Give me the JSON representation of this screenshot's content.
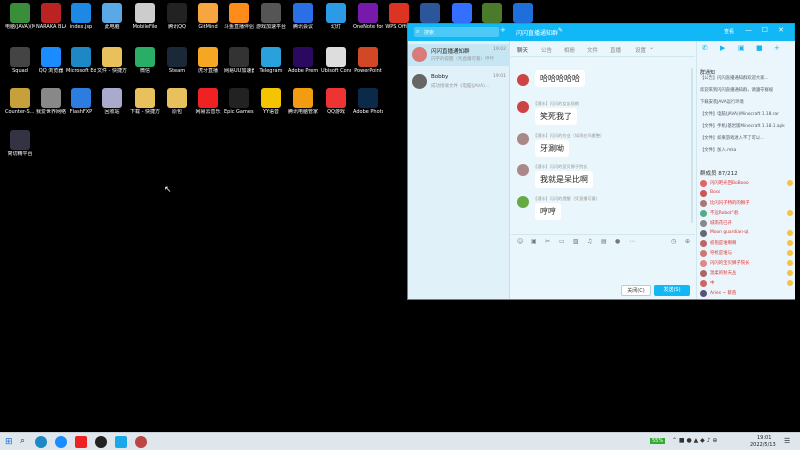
{
  "desktop": {
    "icons": [
      {
        "label": "电脑(JAVA)(Min...",
        "color": "#3a8e3a"
      },
      {
        "label": "NARAKA BLADEPOI...",
        "color": "#b22"
      },
      {
        "label": "index.jsp",
        "color": "#1e88e5"
      },
      {
        "label": "此电脑",
        "color": "#5aa9e6"
      },
      {
        "label": "MobileFile",
        "color": "#ccc"
      },
      {
        "label": "腾讯QQ",
        "color": "#222"
      },
      {
        "label": "GitMind",
        "color": "#f7a541"
      },
      {
        "label": "斗鱼直播伴侣",
        "color": "#ff8c1a"
      },
      {
        "label": "游戏加速平台",
        "color": "#555"
      },
      {
        "label": "腾讯会议",
        "color": "#2b6fe6"
      },
      {
        "label": "幻灯",
        "color": "#2b9be6"
      },
      {
        "label": "OneNote for Windo...",
        "color": "#7719aa"
      },
      {
        "label": "WPS Office",
        "color": "#d32"
      },
      {
        "label": "Word",
        "color": "#2b579a"
      },
      {
        "label": "飞书",
        "color": "#3370ff"
      },
      {
        "label": "Minecraft",
        "color": "#4a7a2a"
      },
      {
        "label": "L",
        "color": "#1e6fd9"
      },
      {
        "label": "Squad",
        "color": "#444"
      },
      {
        "label": "QQ 浏览器",
        "color": "#1a8cff"
      },
      {
        "label": "Microsoft Edge",
        "color": "#1e88c5"
      },
      {
        "label": "文件 - 快捷方式",
        "color": "#e8c15c"
      },
      {
        "label": "微信",
        "color": "#2aae67"
      },
      {
        "label": "Steam",
        "color": "#1b2838"
      },
      {
        "label": "虎牙直播",
        "color": "#f5a623"
      },
      {
        "label": "网易UU加速器",
        "color": "#333"
      },
      {
        "label": "Telegram",
        "color": "#2aa1da"
      },
      {
        "label": "Adobe Premie...",
        "color": "#2a0a5e"
      },
      {
        "label": "Ubisoft Connect",
        "color": "#ddd"
      },
      {
        "label": "PowerPoint",
        "color": "#d24726"
      },
      {
        "label": "Counter-S... Global Off...",
        "color": "#c6a03a"
      },
      {
        "label": "我爱世界网络平台",
        "color": "#888"
      },
      {
        "label": "FlashFXP",
        "color": "#2d7de0"
      },
      {
        "label": "回收站",
        "color": "#aac"
      },
      {
        "label": "下载 - 快捷方式",
        "color": "#e8c15c"
      },
      {
        "label": "原包",
        "color": "#e8c15c"
      },
      {
        "label": "网易云音乐",
        "color": "#e22"
      },
      {
        "label": "Epic Games Launcher",
        "color": "#222"
      },
      {
        "label": "YY语音",
        "color": "#f5c400"
      },
      {
        "label": "腾讯电脑管家",
        "color": "#f39c12"
      },
      {
        "label": "QQ游戏",
        "color": "#e33"
      },
      {
        "label": "Adobe Photosh...",
        "color": "#0b2a4a"
      },
      {
        "label": "简切精平台",
        "color": "#334"
      }
    ]
  },
  "qq_window": {
    "title": "闪闪直播通知群",
    "title_right": "查看",
    "search_placeholder": "搜索",
    "conversations": [
      {
        "name": "闪闪直播通知群",
        "time": "19:02",
        "preview": "闪字的提醒（凭直播可看）哼哼",
        "color": "#d97b7b"
      },
      {
        "name": "Bobby",
        "time": "19:01",
        "preview": "成功接收文件《电脑(JAVA)...",
        "color": "#666"
      }
    ],
    "tabs": [
      "聊天",
      "公告",
      "相册",
      "文件",
      "直播",
      "设置"
    ],
    "messages": [
      {
        "meta": "",
        "text": "哈哈哈哈哈",
        "color": "#c44"
      },
      {
        "meta": "【潜水】闪闪的女友陆鹤",
        "text": "笑死我了",
        "color": "#c44"
      },
      {
        "meta": "【潜水】闪闪的作业（如再在玛搬整）",
        "text": "牙涮呦",
        "color": "#a88"
      },
      {
        "meta": "【潜水】闪闪的室贝狮子院长",
        "text": "我就是呆比啊",
        "color": "#a88"
      },
      {
        "meta": "【潜水】闪闪的提醒（凭直播可看）",
        "text": "哼哼",
        "color": "#6a4"
      }
    ],
    "buttons": {
      "close": "关闭(C)",
      "send": "发送(S)"
    },
    "notice_title": "群通知",
    "announcements": [
      "【公告】闪闪直播通知群欢迎大家...",
      "欢迎来到闪闪直播通知群，请遵守群规",
      "下载安装JAVA运行环境",
      "【文件】电脑(JAVA)(Minecraft 1.18.rar",
      "【文件】手机(基岩版Minecraft 1.18.1.apk",
      "【文件】如果游戏进入不了可以...",
      "【文件】加入.mka"
    ],
    "members_header": "群成员 87/212",
    "members": [
      {
        "name": "闪闪吧光回BoBooo",
        "color": "#d66",
        "badge": true
      },
      {
        "name": "Boss",
        "color": "#c55",
        "badge": false
      },
      {
        "name": "比闪闪子特的的狮子",
        "color": "#a77",
        "badge": false
      },
      {
        "name": "不远Robot°君.",
        "color": "#5a8",
        "badge": true
      },
      {
        "name": "城南花已开",
        "color": "#888",
        "badge": false
      },
      {
        "name": "Moon guardian·ql.",
        "color": "#667",
        "badge": true
      },
      {
        "name": "初抱是谁啊啊",
        "color": "#b66",
        "badge": true
      },
      {
        "name": "夺抢是谁与",
        "color": "#c77",
        "badge": true
      },
      {
        "name": "闪闪的宝贝狮子院长",
        "color": "#d88",
        "badge": true
      },
      {
        "name": "温柔的秋天丛",
        "color": "#a66",
        "badge": true
      },
      {
        "name": "中",
        "color": "#c66",
        "badge": true
      },
      {
        "name": "Aries ~ 蔡茜",
        "color": "#557",
        "badge": false
      }
    ]
  },
  "taskbar": {
    "battery": "55%",
    "time": "19:01",
    "date": "2022/5/13"
  }
}
